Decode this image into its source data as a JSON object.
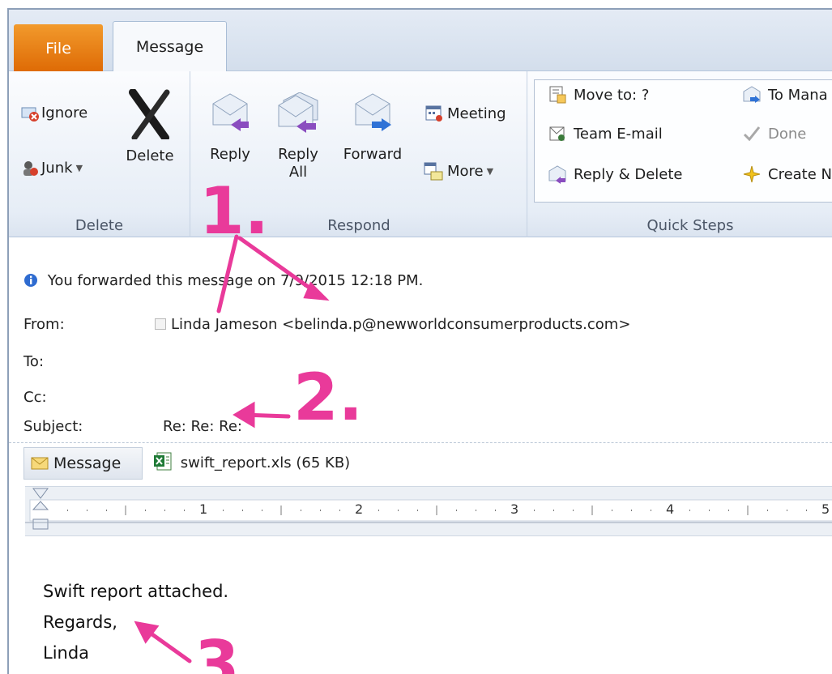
{
  "tabs": {
    "file": "File",
    "message": "Message"
  },
  "ribbon": {
    "delete_group": {
      "ignore": "Ignore",
      "junk": "Junk",
      "delete": "Delete",
      "label": "Delete"
    },
    "respond_group": {
      "reply": "Reply",
      "reply_all_line1": "Reply",
      "reply_all_line2": "All",
      "forward": "Forward",
      "meeting": "Meeting",
      "more": "More",
      "label": "Respond"
    },
    "quick_steps": {
      "move_to": "Move to: ?",
      "team_email": "Team E-mail",
      "reply_delete": "Reply & Delete",
      "to_manager": "To Mana",
      "done": "Done",
      "create_new": "Create N",
      "label": "Quick Steps"
    }
  },
  "header": {
    "info": "You forwarded this message on 7/9/2015 12:18 PM.",
    "from_label": "From:",
    "from_value": "Linda Jameson <belinda.p@newworldconsumerproducts.com>",
    "to_label": "To:",
    "cc_label": "Cc:",
    "subject_label": "Subject:",
    "subject_value": "Re: Re: Re:"
  },
  "attachments": {
    "message_tab": "Message",
    "file": "swift_report.xls (65 KB)"
  },
  "ruler": {
    "numbers": [
      "1",
      "2",
      "3",
      "4",
      "5"
    ]
  },
  "body": {
    "line1": "Swift report attached.",
    "line2": "Regards,",
    "line3": "Linda"
  },
  "annotations": {
    "n1": "1.",
    "n2": "2.",
    "n3": "3"
  },
  "colors": {
    "annotation": "#e93a9a",
    "file_tab": "#e8800f",
    "accent": "#2b579a"
  }
}
